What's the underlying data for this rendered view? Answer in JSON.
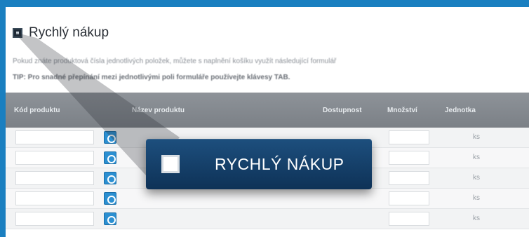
{
  "section": {
    "title": "Rychlý nákup",
    "description": "Pokud znáte produktová čísla jednotlivých položek, můžete s naplnění košíku využít následující formulář",
    "tip": "TIP: Pro snadné přepínání mezi jednotlivými poli formuláře používejte klávesy TAB."
  },
  "table": {
    "headers": {
      "code": "Kód produktu",
      "name": "Název produktu",
      "availability": "Dostupnost",
      "quantity": "Množství",
      "unit": "Jednotka"
    },
    "rows": [
      {
        "unit": "ks"
      },
      {
        "unit": "ks"
      },
      {
        "unit": "ks"
      },
      {
        "unit": "ks"
      },
      {
        "unit": "ks"
      }
    ]
  },
  "overlay": {
    "button_label": "RYCHLÝ NÁKUP"
  },
  "colors": {
    "frame_accent": "#1a7fc0",
    "header_bg": "#7b8086",
    "button_bg": "#0e3257"
  }
}
